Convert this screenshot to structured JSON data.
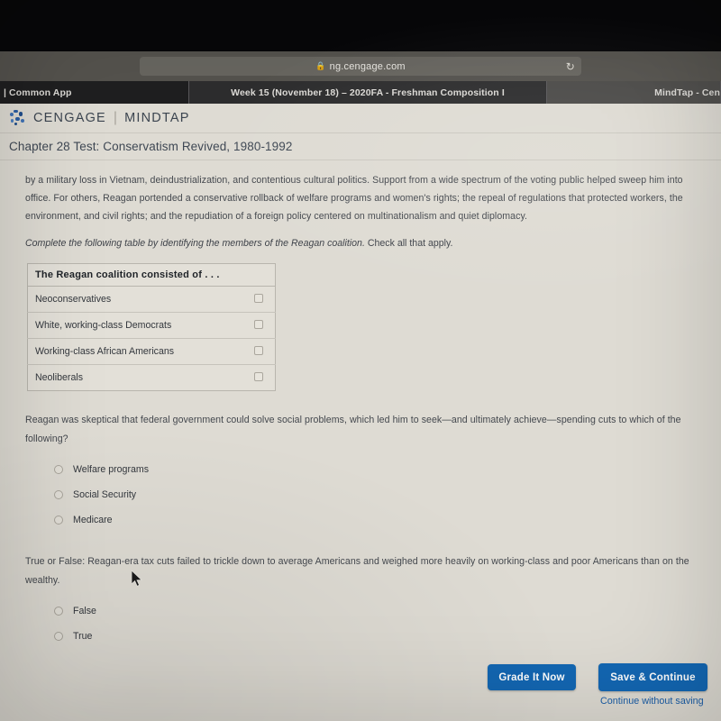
{
  "browser": {
    "url": "ng.cengage.com",
    "lock_icon": "lock-icon",
    "reload_icon": "reload-icon",
    "tabs": [
      {
        "label": "| Common App"
      },
      {
        "label": "Week 15 (November 18) – 2020FA - Freshman Composition I"
      },
      {
        "label": "MindTap - Cen"
      }
    ]
  },
  "header": {
    "brand": "CENGAGE",
    "divider": "|",
    "product": "MINDTAP",
    "logo_icon": "cengage-dots-logo-icon"
  },
  "chapter": {
    "title": "Chapter 28 Test: Conservatism Revived, 1980-1992"
  },
  "body": {
    "paragraph": "by a military loss in Vietnam, deindustrialization, and contentious cultural politics. Support from a wide spectrum of the voting public helped sweep him into office. For others, Reagan portended a conservative rollback of welfare programs and women's rights; the repeal of regulations that protected workers, the environment, and civil rights; and the repudiation of a foreign policy centered on multinationalism and quiet diplomacy.",
    "instruction_italic": "Complete the following table by identifying the members of the Reagan coalition.",
    "instruction_normal": "Check all that apply."
  },
  "table": {
    "header": "The Reagan coalition consisted of . . .",
    "rows": [
      {
        "label": "Neoconservatives",
        "checked": false
      },
      {
        "label": "White, working-class Democrats",
        "checked": false
      },
      {
        "label": "Working-class African Americans",
        "checked": false
      },
      {
        "label": "Neoliberals",
        "checked": false
      }
    ]
  },
  "question2": {
    "text": "Reagan was skeptical that federal government could solve social problems, which led him to seek—and ultimately achieve—spending cuts to which of the following?",
    "options": [
      {
        "label": "Welfare programs",
        "selected": false
      },
      {
        "label": "Social Security",
        "selected": false
      },
      {
        "label": "Medicare",
        "selected": false
      }
    ]
  },
  "question3": {
    "text": "True or False: Reagan-era tax cuts failed to trickle down to average Americans and weighed more heavily on working-class and poor Americans than on the wealthy.",
    "options": [
      {
        "label": "False",
        "selected": false
      },
      {
        "label": "True",
        "selected": false
      }
    ]
  },
  "footer": {
    "grade_label": "Grade It Now",
    "save_label": "Save & Continue",
    "continue_link": "Continue without saving",
    "button_color": "#1367b3",
    "link_color": "#1a5ea8"
  },
  "page_background": "#dedbd3"
}
